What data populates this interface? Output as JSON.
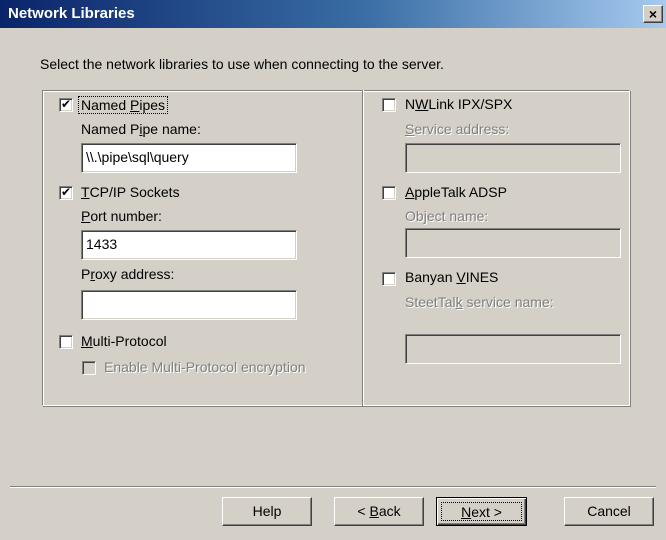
{
  "window": {
    "title": "Network Libraries",
    "close_label": "×"
  },
  "instruction": "Select the network libraries to use when connecting to the server.",
  "left": {
    "named_pipes": {
      "checked": true,
      "label_pre": "Named ",
      "label_u": "P",
      "label_post": "ipes",
      "field_label_pre": "Named P",
      "field_label_u": "i",
      "field_label_post": "pe name:",
      "value": "\\\\.\\pipe\\sql\\query"
    },
    "tcpip": {
      "checked": true,
      "label_u": "T",
      "label_post": "CP/IP Sockets",
      "port_label_u": "P",
      "port_label_post": "ort number:",
      "port_value": "1433",
      "proxy_label_pre": "P",
      "proxy_label_u": "r",
      "proxy_label_post": "oxy address:",
      "proxy_value": ""
    },
    "multiprotocol": {
      "checked": false,
      "label_u": "M",
      "label_post": "ulti-Protocol",
      "encryption_label": "Enable Multi-Protocol encryption"
    }
  },
  "right": {
    "nwlink": {
      "checked": false,
      "label_pre": "N",
      "label_u": "W",
      "label_post": "Link IPX/SPX",
      "field_label_u": "S",
      "field_label_post": "ervice address:",
      "value": ""
    },
    "appletalk": {
      "checked": false,
      "label_u": "A",
      "label_post": "ppleTalk ADSP",
      "field_label_pre": "Ob",
      "field_label_u": "j",
      "field_label_post": "ect name:",
      "value": ""
    },
    "banyan": {
      "checked": false,
      "label_pre": "Banyan ",
      "label_u": "V",
      "label_post": "INES",
      "field_label_pre": "SteetTal",
      "field_label_u": "k",
      "field_label_post": " service name:",
      "value": ""
    }
  },
  "buttons": {
    "help": "Help",
    "back_pre": "< ",
    "back_u": "B",
    "back_post": "ack",
    "next_u": "N",
    "next_post": "ext >",
    "cancel": "Cancel"
  }
}
